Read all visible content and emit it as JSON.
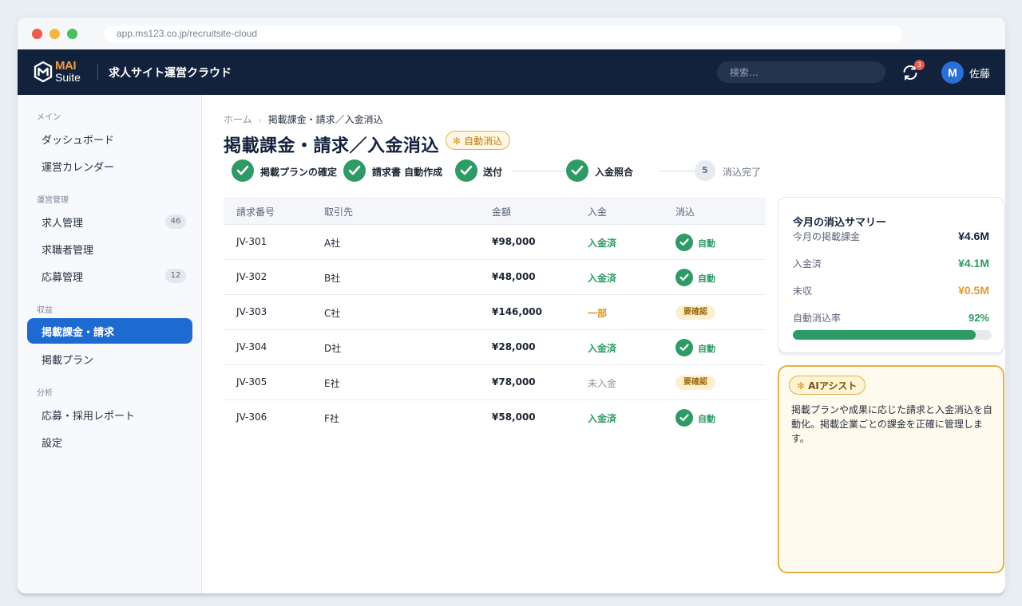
{
  "browser": {
    "url": "app.ms123.co.jp/recruitsite-cloud"
  },
  "header": {
    "logo_top": "MAI",
    "logo_bottom": "Suite",
    "app_title": "求人サイト運営クラウド",
    "search_placeholder": "検索…",
    "notification_count": "3",
    "avatar_initial": "M",
    "user_name": "佐藤"
  },
  "sidebar": {
    "sections": [
      {
        "title": "メイン",
        "items": [
          {
            "label": "ダッシュボード"
          },
          {
            "label": "運営カレンダー"
          }
        ]
      },
      {
        "title": "運営管理",
        "items": [
          {
            "label": "求人管理",
            "count": "46"
          },
          {
            "label": "求職者管理"
          },
          {
            "label": "応募管理",
            "count": "12"
          }
        ]
      },
      {
        "title": "収益",
        "items": [
          {
            "label": "掲載課金・請求",
            "active": true
          },
          {
            "label": "掲載プラン"
          }
        ]
      },
      {
        "title": "分析",
        "items": [
          {
            "label": "応募・採用レポート"
          },
          {
            "label": "設定"
          }
        ]
      }
    ]
  },
  "page": {
    "breadcrumb": [
      "ホーム",
      "掲載課金・請求／入金消込"
    ],
    "title": "掲載課金・請求／入金消込",
    "badge": "自動消込"
  },
  "steps": [
    {
      "label": "掲載プランの確定",
      "done": true
    },
    {
      "label": "請求書 自動作成",
      "done": true
    },
    {
      "label": "送付",
      "done": true
    },
    {
      "label": "入金照合",
      "done": true
    },
    {
      "number": "5",
      "label": "消込完了",
      "done": false
    }
  ],
  "table": {
    "headers": [
      "請求番号",
      "取引先",
      "金額",
      "入金",
      "消込"
    ],
    "rows": [
      {
        "id": "JV-301",
        "client": "A社",
        "amount": "¥98,000",
        "payment": "入金済",
        "payment_status": "paid",
        "recon": "自動",
        "recon_type": "auto"
      },
      {
        "id": "JV-302",
        "client": "B社",
        "amount": "¥48,000",
        "payment": "入金済",
        "payment_status": "paid",
        "recon": "自動",
        "recon_type": "auto"
      },
      {
        "id": "JV-303",
        "client": "C社",
        "amount": "¥146,000",
        "payment": "一部",
        "payment_status": "partial",
        "recon": "要確認",
        "recon_type": "check"
      },
      {
        "id": "JV-304",
        "client": "D社",
        "amount": "¥28,000",
        "payment": "入金済",
        "payment_status": "paid",
        "recon": "自動",
        "recon_type": "auto"
      },
      {
        "id": "JV-305",
        "client": "E社",
        "amount": "¥78,000",
        "payment": "未入金",
        "payment_status": "unpaid",
        "recon": "要確認",
        "recon_type": "check"
      },
      {
        "id": "JV-306",
        "client": "F社",
        "amount": "¥58,000",
        "payment": "入金済",
        "payment_status": "paid",
        "recon": "自動",
        "recon_type": "auto"
      }
    ]
  },
  "summary": {
    "title": "今月の消込サマリー",
    "rows": [
      {
        "label": "今月の掲載課金",
        "value": "¥4.6M",
        "color": "#13223c"
      },
      {
        "label": "入金済",
        "value": "¥4.1M",
        "color": "#2e9a65"
      },
      {
        "label": "未収",
        "value": "¥0.5M",
        "color": "#e59a2c"
      }
    ],
    "rate_label": "自動消込率",
    "rate_value": "92%",
    "rate_fraction": 0.92
  },
  "assist": {
    "badge": "AIアシスト",
    "text": "掲載プランや成果に応じた請求と入金消込を自動化。掲載企業ごとの課金を正確に管理します。"
  },
  "colors": {
    "header_bg": "#13223c",
    "accent_blue": "#1d6ad1",
    "success_green": "#2e9a65",
    "warning_amber": "#e2b14a"
  }
}
